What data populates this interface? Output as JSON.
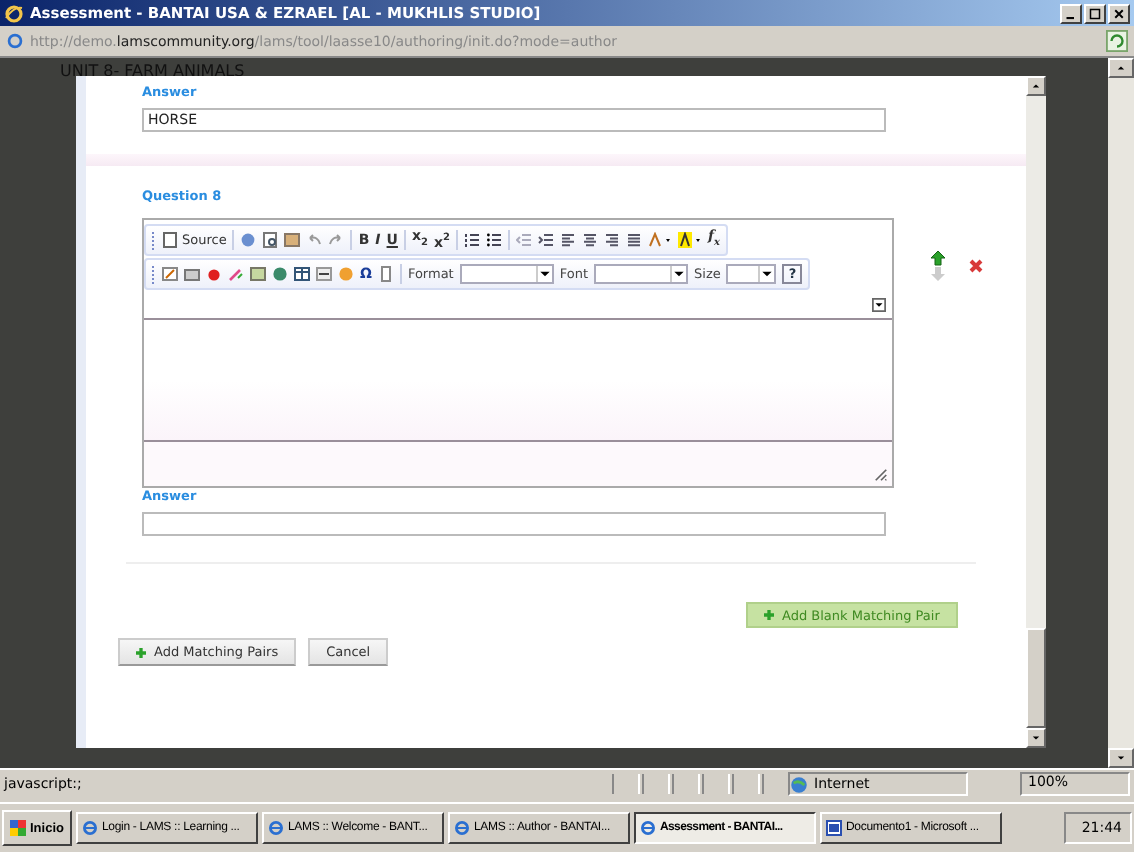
{
  "window": {
    "title": "Assessment - BANTAI USA & EZRAEL [AL - MUKHLIS STUDIO]"
  },
  "address_bar": {
    "url": "http://demo.**lamscommunity.org**/lams/tool/laasse10/authoring/init.do?mode=author"
  },
  "page": {
    "heading": "UNIT 8- FARM ANIMALS"
  },
  "dialog": {
    "answer_1": {
      "label": "Answer",
      "value": "HORSE"
    },
    "question": {
      "label": "Question 8"
    },
    "editor": {
      "source_label": "Source",
      "bold": "B",
      "italic": "I",
      "underline": "U",
      "subscript": "x$_{2}$",
      "superscript": "x$^{2}$",
      "formula": "f$_{x}$",
      "omega": "Ω",
      "format_label": "Format",
      "font_label": "Font",
      "size_label": "Size",
      "help": "?"
    },
    "answer_2": {
      "label": "Answer"
    },
    "buttons": [
      {
        "kind": "blank",
        "label": "Add Blank Matching Pair"
      },
      {
        "kind": "add",
        "label": "Add Matching Pairs"
      },
      {
        "kind": "plain",
        "label": "Cancel"
      }
    ]
  },
  "status_bar": {
    "text": "javascript:;",
    "zone": "Internet",
    "zoom": "100%"
  },
  "taskbar": {
    "start": "Inicio",
    "clock": "21:44",
    "tasks": [
      {
        "label": "Login - LAMS :: Learning ...",
        "kind": "ie",
        "selected": false
      },
      {
        "label": "LAMS :: Welcome - BANT...",
        "kind": "ie",
        "selected": false
      },
      {
        "label": "LAMS :: Author - BANTAI...",
        "kind": "ie",
        "selected": false
      },
      {
        "label": "Assessment - BANTAI...",
        "kind": "ie",
        "selected": true
      },
      {
        "label": "Documento1 - Microsoft ...",
        "kind": "word",
        "selected": false
      }
    ]
  }
}
